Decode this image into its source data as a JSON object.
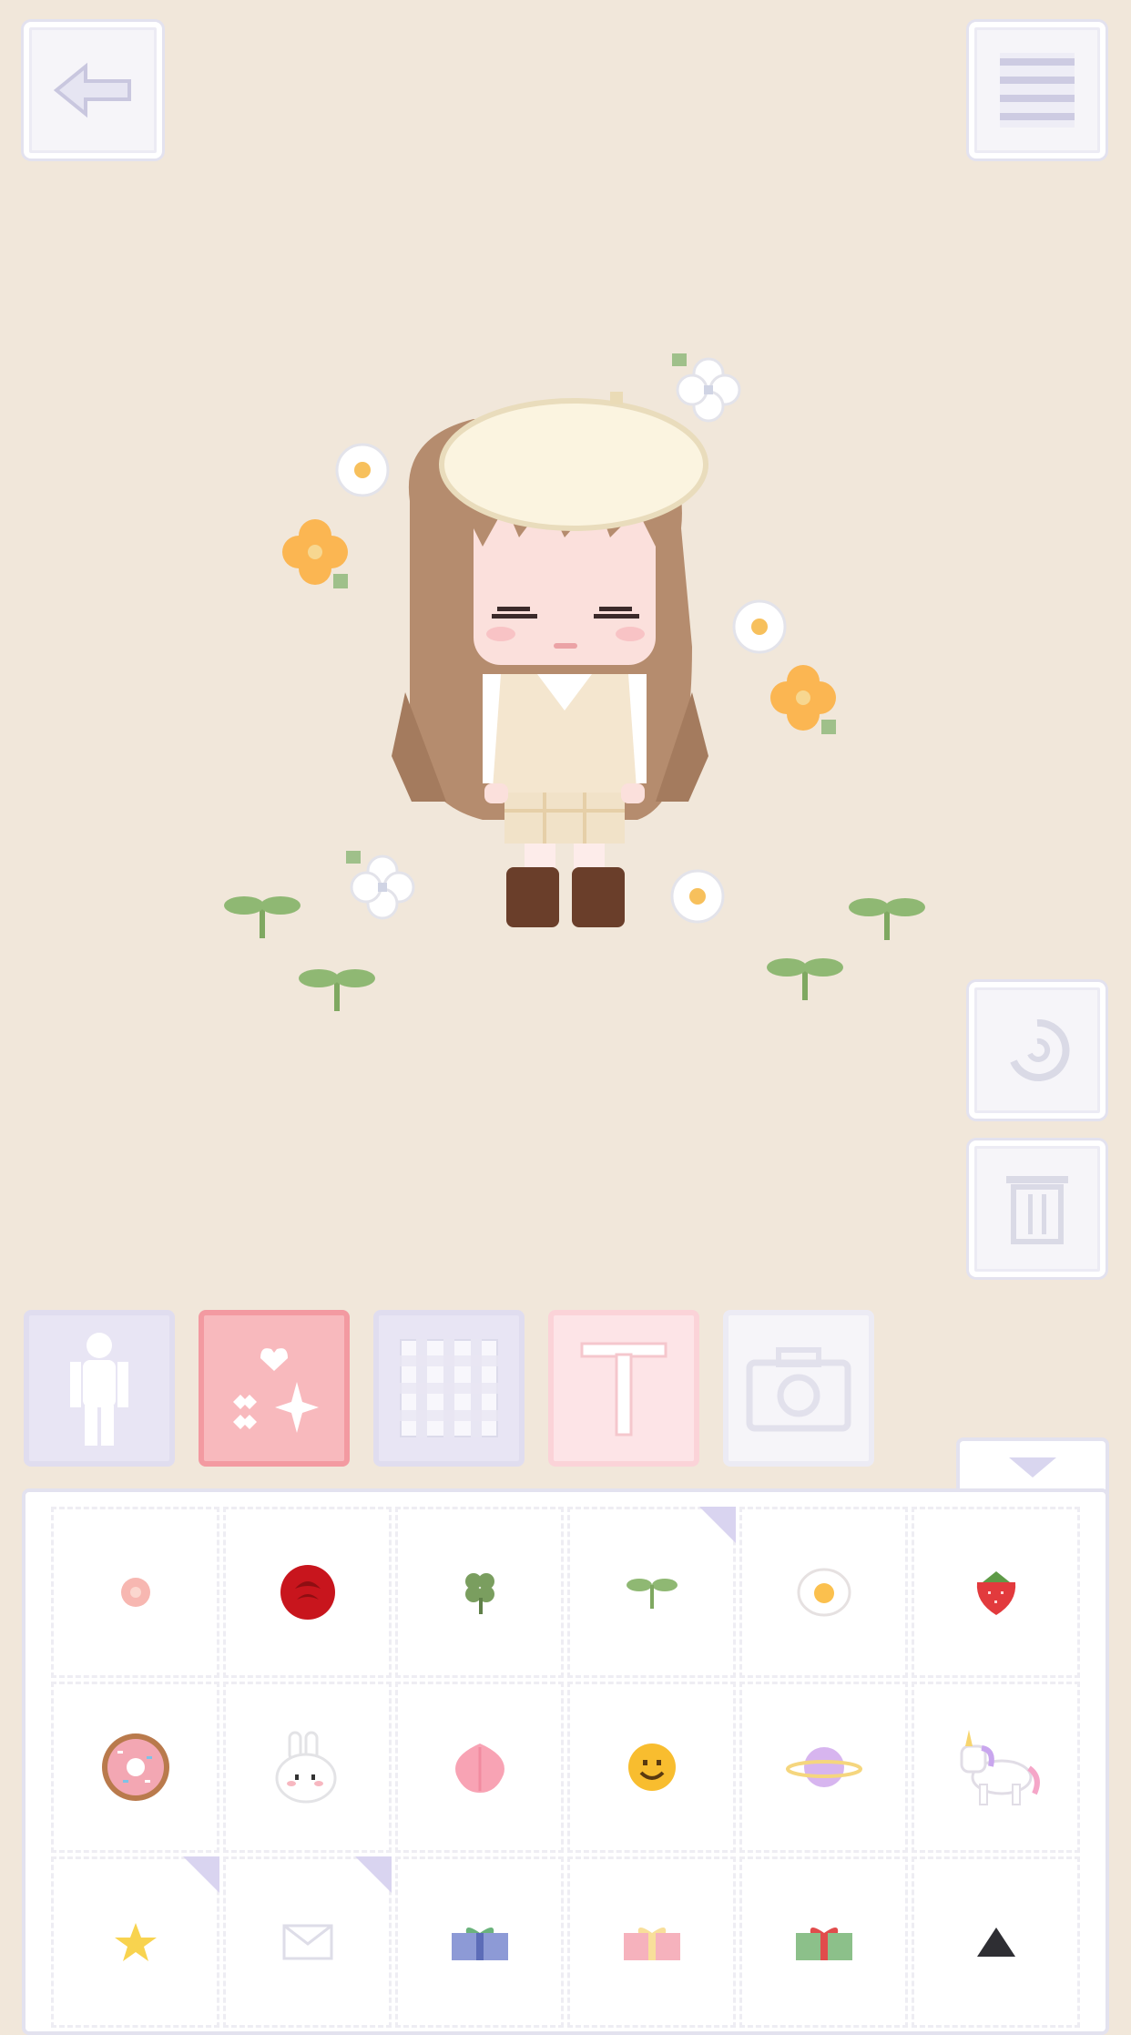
{
  "toolbar": {
    "back_icon": "back-arrow-icon",
    "menu_icon": "hamburger-menu-icon",
    "rotate_icon": "rotate-icon",
    "delete_icon": "trash-icon"
  },
  "tabs": [
    {
      "id": "avatar",
      "icon": "body-silhouette-icon",
      "active": false
    },
    {
      "id": "stickers",
      "icon": "sparkle-heart-icon",
      "active": true
    },
    {
      "id": "background",
      "icon": "gingham-pattern-icon",
      "active": false
    },
    {
      "id": "text",
      "icon": "text-t-icon",
      "active": false
    },
    {
      "id": "camera",
      "icon": "camera-icon",
      "active": false
    }
  ],
  "panel_toggle_icon": "triangle-down-icon",
  "stickers": [
    [
      "pink-flower-sticker",
      "red-rose-sticker",
      "four-leaf-clover-sticker",
      "sprout-sticker",
      "fried-egg-sticker",
      "strawberry-sticker"
    ],
    [
      "donut-sticker",
      "bunny-sticker",
      "peach-sticker",
      "smiley-sticker",
      "planet-sticker",
      "unicorn-sticker"
    ],
    [
      "star-sticker",
      "envelope-sticker",
      "blue-gift-sticker",
      "pink-gift-sticker",
      "green-gift-sticker",
      "black-triangle-sticker"
    ]
  ],
  "colors": {
    "background": "#f1e7da",
    "active_tab": "#f8b9bd",
    "panel_border": "#e3e2ef"
  }
}
